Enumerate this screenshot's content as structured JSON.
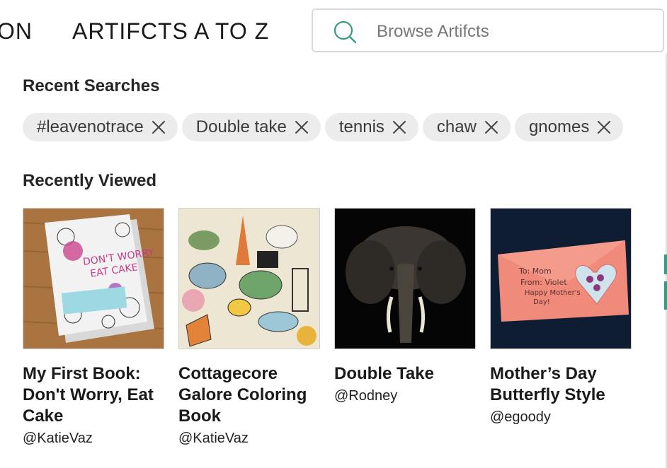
{
  "nav": {
    "partial_item": "ON",
    "atoz_label": "ARTIFCTS A TO Z"
  },
  "search": {
    "placeholder": "Browse Artifcts",
    "icon": "search-icon"
  },
  "recent_searches": {
    "title": "Recent Searches",
    "items": [
      {
        "label": "#leavenotrace"
      },
      {
        "label": "Double take"
      },
      {
        "label": "tennis"
      },
      {
        "label": "chaw"
      },
      {
        "label": "gnomes"
      }
    ]
  },
  "recently_viewed": {
    "title": "Recently Viewed",
    "items": [
      {
        "title": "My First Book: Don't Worry, Eat Cake",
        "user": "@KatieVaz"
      },
      {
        "title": "Cottagecore Galore Coloring Book",
        "user": "@KatieVaz"
      },
      {
        "title": "Double Take",
        "user": "@Rodney"
      },
      {
        "title": "Mother’s Day Butterfly Style",
        "user": "@egoody"
      }
    ]
  },
  "colors": {
    "accent": "#3a9a86",
    "chip_bg": "#ececec"
  }
}
